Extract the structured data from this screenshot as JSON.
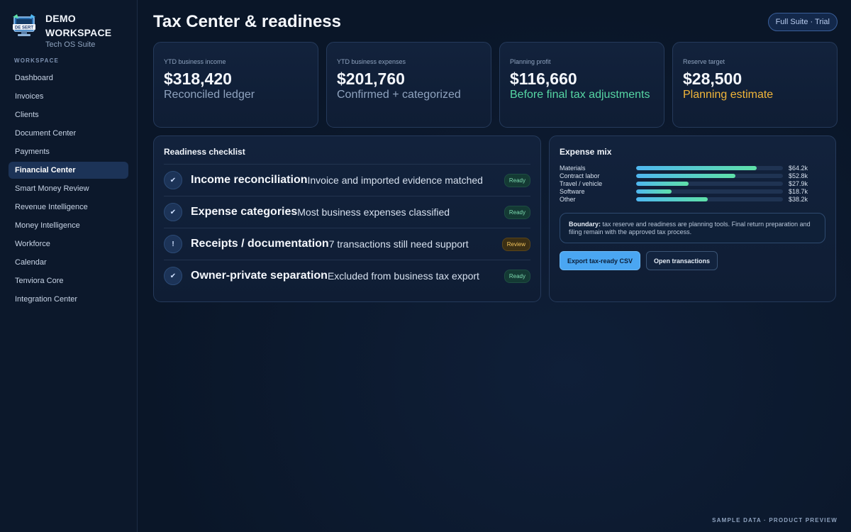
{
  "brand": {
    "name_line1": "DEMO",
    "name_line2": "WORKSPACE",
    "subtitle": "Tech OS Suite",
    "logo_text": "DE SERT"
  },
  "sidebar": {
    "section_label": "WORKSPACE",
    "items": [
      {
        "label": "Dashboard",
        "active": false
      },
      {
        "label": "Invoices",
        "active": false
      },
      {
        "label": "Clients",
        "active": false
      },
      {
        "label": "Document Center",
        "active": false
      },
      {
        "label": "Payments",
        "active": false
      },
      {
        "label": "Financial Center",
        "active": true
      },
      {
        "label": "Smart Money Review",
        "active": false
      },
      {
        "label": "Revenue Intelligence",
        "active": false
      },
      {
        "label": "Money Intelligence",
        "active": false
      },
      {
        "label": "Workforce",
        "active": false
      },
      {
        "label": "Calendar",
        "active": false
      },
      {
        "label": "Tenviora Core",
        "active": false
      },
      {
        "label": "Integration Center",
        "active": false
      }
    ]
  },
  "header": {
    "title": "Tax Center & readiness",
    "plan_badge": "Full Suite · Trial"
  },
  "stats": [
    {
      "label": "YTD business income",
      "value": "$318,420",
      "note": "Reconciled ledger",
      "tone": "muted"
    },
    {
      "label": "YTD business expenses",
      "value": "$201,760",
      "note": "Confirmed + categorized",
      "tone": "muted"
    },
    {
      "label": "Planning profit",
      "value": "$116,660",
      "note": "Before final tax adjustments",
      "tone": "green"
    },
    {
      "label": "Reserve target",
      "value": "$28,500",
      "note": "Planning estimate",
      "tone": "amber"
    }
  ],
  "checklist": {
    "title": "Readiness checklist",
    "items": [
      {
        "icon": "✔",
        "icon_name": "check-icon",
        "title": "Income reconciliation",
        "desc": "Invoice and imported evidence matched",
        "status": "Ready",
        "status_tone": "ready"
      },
      {
        "icon": "✔",
        "icon_name": "check-icon",
        "title": "Expense categories",
        "desc": "Most business expenses classified",
        "status": "Ready",
        "status_tone": "ready"
      },
      {
        "icon": "!",
        "icon_name": "alert-icon",
        "title": "Receipts / documentation",
        "desc": "7 transactions still need support",
        "status": "Review",
        "status_tone": "review"
      },
      {
        "icon": "✔",
        "icon_name": "check-icon",
        "title": "Owner-private separation",
        "desc": "Excluded from business tax export",
        "status": "Ready",
        "status_tone": "ready"
      }
    ]
  },
  "expense_mix": {
    "title": "Expense mix",
    "scale_max": 78,
    "rows": [
      {
        "label": "Materials",
        "value_k": 64.2,
        "value": "$64.2k"
      },
      {
        "label": "Contract labor",
        "value_k": 52.8,
        "value": "$52.8k"
      },
      {
        "label": "Travel / vehicle",
        "value_k": 27.9,
        "value": "$27.9k"
      },
      {
        "label": "Software",
        "value_k": 18.7,
        "value": "$18.7k"
      },
      {
        "label": "Other",
        "value_k": 38.2,
        "value": "$38.2k"
      }
    ],
    "boundary_label": "Boundary:",
    "boundary_text": "tax reserve and readiness are planning tools. Final return preparation and filing remain with the approved tax process.",
    "export_button": "Export tax-ready CSV",
    "open_button": "Open transactions"
  },
  "footer": {
    "tag": "SAMPLE DATA · PRODUCT PREVIEW"
  },
  "colors": {
    "background": "#0a1628",
    "accent": "#4aa6f2",
    "green": "#56d6a4",
    "amber": "#f2b63a",
    "active_nav": "#1c3357"
  }
}
